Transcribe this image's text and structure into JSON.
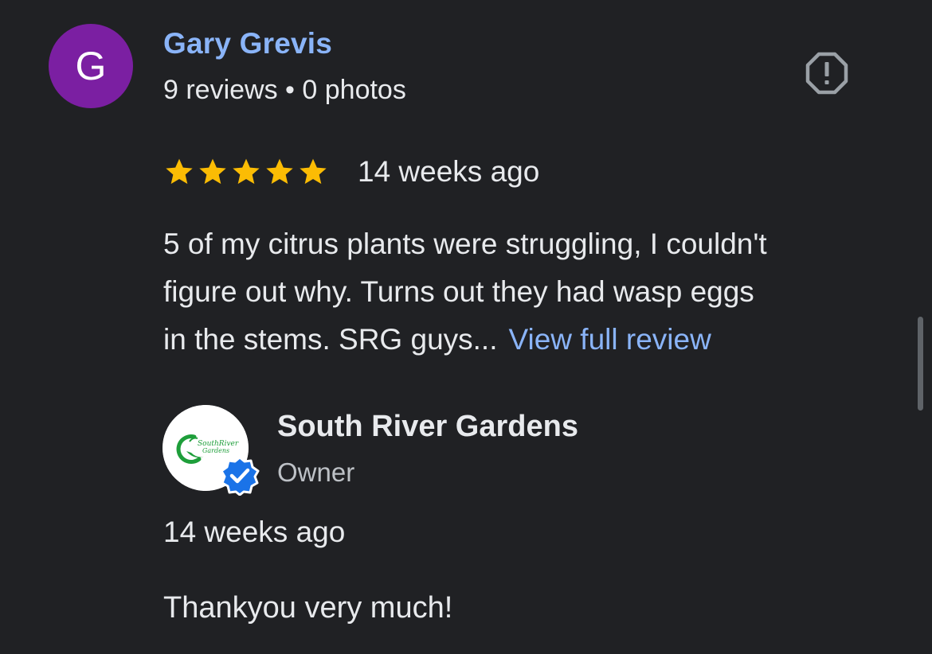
{
  "review": {
    "avatar_letter": "G",
    "avatar_color": "#7b1fa2",
    "reviewer_name": "Gary Grevis",
    "reviewer_meta": "9 reviews • 0 photos",
    "rating": 5,
    "rating_max": 5,
    "star_color": "#fbbc04",
    "time": "14 weeks ago",
    "text_lines": [
      "5 of my citrus plants were struggling, I couldn't",
      "figure out why. Turns out they had wasp eggs",
      "in the stems. SRG guys..."
    ],
    "view_full_label": "View full review",
    "report_icon": "report-flag-icon"
  },
  "owner_reply": {
    "business_name": "South River Gardens",
    "role": "Owner",
    "logo_text": "SouthRiver Gardens",
    "verified_icon": "verified-badge-icon",
    "time": "14 weeks ago",
    "text": "Thankyou very much!"
  },
  "colors": {
    "background": "#202124",
    "link": "#8ab4f8",
    "text": "#e8eaed",
    "verified": "#1a73e8"
  }
}
